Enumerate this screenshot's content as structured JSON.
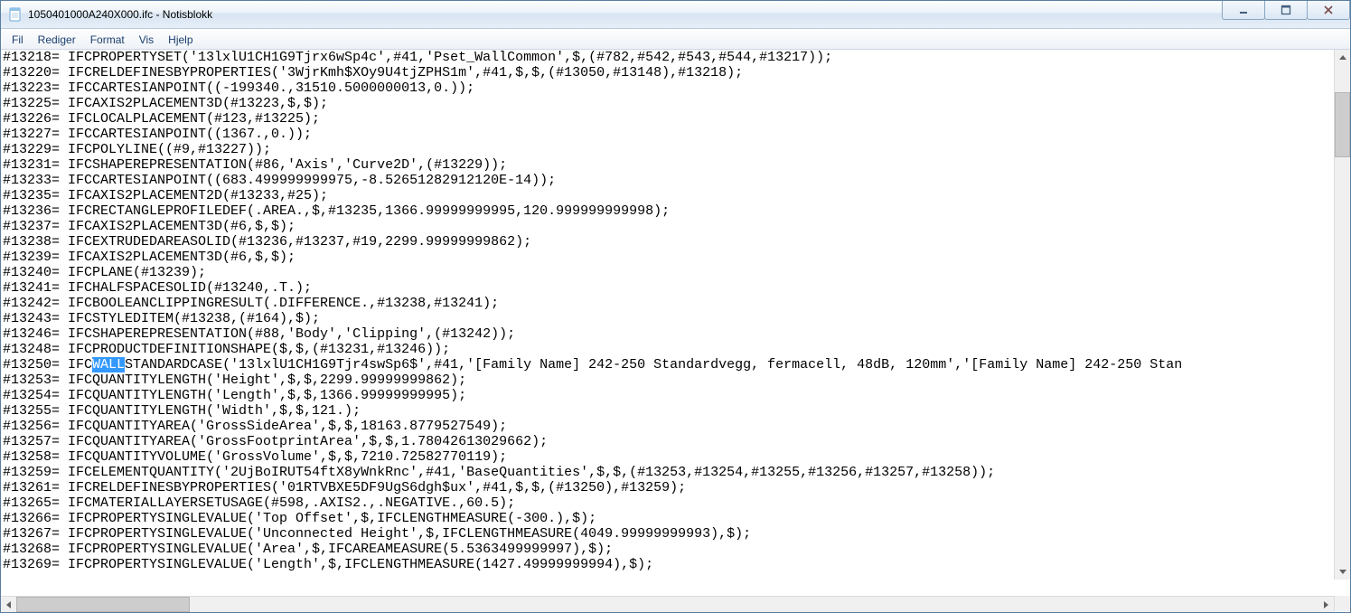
{
  "window": {
    "title": "1050401000A240X000.ifc - Notisblokk"
  },
  "menu": {
    "fil": "Fil",
    "rediger": "Rediger",
    "format": "Format",
    "vis": "Vis",
    "hjelp": "Hjelp"
  },
  "highlight": {
    "text": "WALL"
  },
  "lines": {
    "l00": "#13218= IFCPROPERTYSET('13lxlU1CH1G9Tjrx6wSp4c',#41,'Pset_WallCommon',$,(#782,#542,#543,#544,#13217));",
    "l01": "#13220= IFCRELDEFINESBYPROPERTIES('3WjrKmh$XOy9U4tjZPHS1m',#41,$,$,(#13050,#13148),#13218);",
    "l02": "#13223= IFCCARTESIANPOINT((-199340.,31510.5000000013,0.));",
    "l03": "#13225= IFCAXIS2PLACEMENT3D(#13223,$,$);",
    "l04": "#13226= IFCLOCALPLACEMENT(#123,#13225);",
    "l05": "#13227= IFCCARTESIANPOINT((1367.,0.));",
    "l06": "#13229= IFCPOLYLINE((#9,#13227));",
    "l07": "#13231= IFCSHAPEREPRESENTATION(#86,'Axis','Curve2D',(#13229));",
    "l08": "#13233= IFCCARTESIANPOINT((683.499999999975,-8.52651282912120E-14));",
    "l09": "#13235= IFCAXIS2PLACEMENT2D(#13233,#25);",
    "l10": "#13236= IFCRECTANGLEPROFILEDEF(.AREA.,$,#13235,1366.99999999995,120.999999999998);",
    "l11": "#13237= IFCAXIS2PLACEMENT3D(#6,$,$);",
    "l12": "#13238= IFCEXTRUDEDAREASOLID(#13236,#13237,#19,2299.99999999862);",
    "l13": "#13239= IFCAXIS2PLACEMENT3D(#6,$,$);",
    "l14": "#13240= IFCPLANE(#13239);",
    "l15": "#13241= IFCHALFSPACESOLID(#13240,.T.);",
    "l16": "#13242= IFCBOOLEANCLIPPINGRESULT(.DIFFERENCE.,#13238,#13241);",
    "l17": "#13243= IFCSTYLEDITEM(#13238,(#164),$);",
    "l18": "#13246= IFCSHAPEREPRESENTATION(#88,'Body','Clipping',(#13242));",
    "l19": "#13248= IFCPRODUCTDEFINITIONSHAPE($,$,(#13231,#13246));",
    "l20a": "#13250= IFC",
    "l20b": "STANDARDCASE('13lxlU1CH1G9Tjr4swSp6$',#41,'[Family Name] 242-250 Standardvegg, fermacell, 48dB, 120mm','[Family Name] 242-250 Stan",
    "l21": "#13253= IFCQUANTITYLENGTH('Height',$,$,2299.99999999862);",
    "l22": "#13254= IFCQUANTITYLENGTH('Length',$,$,1366.99999999995);",
    "l23": "#13255= IFCQUANTITYLENGTH('Width',$,$,121.);",
    "l24": "#13256= IFCQUANTITYAREA('GrossSideArea',$,$,18163.8779527549);",
    "l25": "#13257= IFCQUANTITYAREA('GrossFootprintArea',$,$,1.78042613029662);",
    "l26": "#13258= IFCQUANTITYVOLUME('GrossVolume',$,$,7210.72582770119);",
    "l27": "#13259= IFCELEMENTQUANTITY('2UjBoIRUT54ftX8yWnkRnc',#41,'BaseQuantities',$,$,(#13253,#13254,#13255,#13256,#13257,#13258));",
    "l28": "#13261= IFCRELDEFINESBYPROPERTIES('01RTVBXE5DF9UgS6dgh$ux',#41,$,$,(#13250),#13259);",
    "l29": "#13265= IFCMATERIALLAYERSETUSAGE(#598,.AXIS2.,.NEGATIVE.,60.5);",
    "l30": "#13266= IFCPROPERTYSINGLEVALUE('Top Offset',$,IFCLENGTHMEASURE(-300.),$);",
    "l31": "#13267= IFCPROPERTYSINGLEVALUE('Unconnected Height',$,IFCLENGTHMEASURE(4049.99999999993),$);",
    "l32": "#13268= IFCPROPERTYSINGLEVALUE('Area',$,IFCAREAMEASURE(5.5363499999997),$);",
    "l33": "#13269= IFCPROPERTYSINGLEVALUE('Length',$,IFCLENGTHMEASURE(1427.49999999994),$);"
  }
}
